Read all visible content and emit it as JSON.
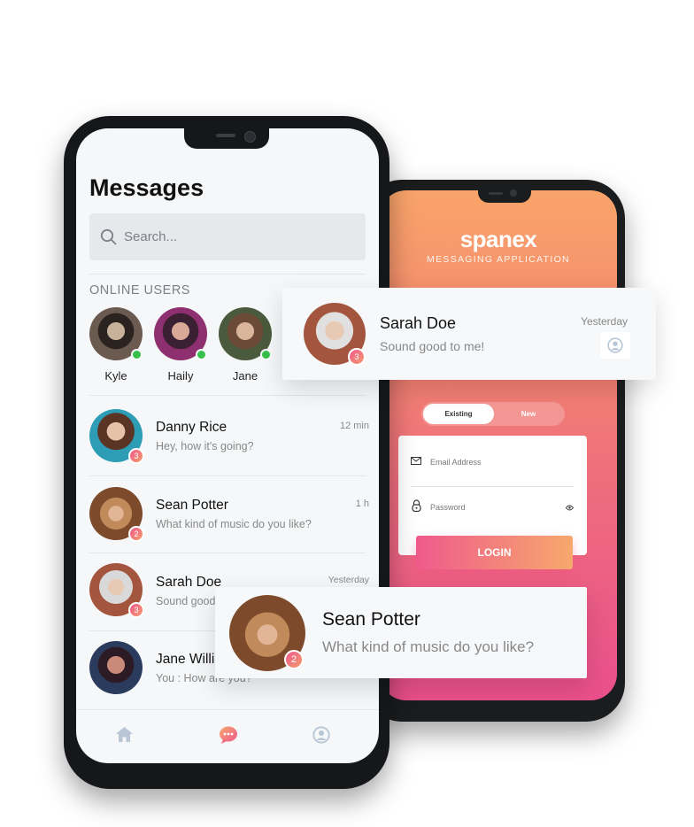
{
  "back_phone": {
    "brand": "spanex",
    "brand_sub": "MESSAGING APPLICATION",
    "tabs": [
      "Existing",
      "New"
    ],
    "email_label": "Email Address",
    "password_label": "Password",
    "login_label": "LOGIN"
  },
  "messages_screen": {
    "title": "Messages",
    "search_placeholder": "Search...",
    "online_section": "ONLINE USERS",
    "online_users": [
      {
        "name": "Kyle"
      },
      {
        "name": "Haily"
      },
      {
        "name": "Jane"
      }
    ],
    "chats": [
      {
        "name": "Danny Rice",
        "message": "Hey, how it's going?",
        "time": "12 min",
        "badge": "3"
      },
      {
        "name": "Sean Potter",
        "message": "What kind of music do you like?",
        "time": "1 h",
        "badge": "2"
      },
      {
        "name": "Sarah Doe",
        "message": "Sound good to me!",
        "time": "Yesterday",
        "badge": "3"
      },
      {
        "name": "Jane Williams",
        "message": "You : How are you?",
        "time": "",
        "badge": ""
      }
    ],
    "nav": [
      "home-icon",
      "chat-icon",
      "profile-icon"
    ]
  },
  "float_card_top": {
    "name": "Sarah Doe",
    "message": "Sound good to me!",
    "time": "Yesterday",
    "badge": "3"
  },
  "float_card_bottom": {
    "name": "Sean Potter",
    "message": "What kind of music do you like?",
    "badge": "2"
  },
  "colors": {
    "accent_pink": "#ef5a8c",
    "accent_orange": "#f7a86d",
    "online_green": "#36c04b"
  }
}
